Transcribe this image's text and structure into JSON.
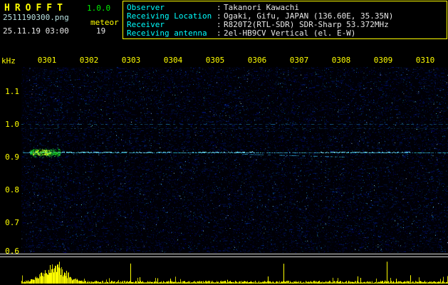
{
  "header": {
    "app_title": "HROFFT",
    "version": "1.0.0",
    "filename": "2511190300.png",
    "mode": "meteor",
    "datetime": "25.11.19 03:00",
    "count": "19",
    "info": {
      "sep": ":",
      "rows": [
        {
          "label": "Observer",
          "value": "Takanori Kawachi"
        },
        {
          "label": "Receiving Location",
          "value": "Ogaki, Gifu, JAPAN (136.60E, 35.35N)"
        },
        {
          "label": "Receiver",
          "value": "R820T2(RTL-SDR) SDR-Sharp 53.372MHz"
        },
        {
          "label": "Receiving antenna",
          "value": "2el-HB9CV Vertical (el. E-W)"
        }
      ]
    }
  },
  "axes": {
    "freq_unit": "kHz",
    "freq_labels": [
      "1.1",
      "1.0",
      "0.9",
      "0.8",
      "0.7",
      "0.6"
    ],
    "time_labels": [
      "0301",
      "0302",
      "0303",
      "0304",
      "0305",
      "0306",
      "0307",
      "0308",
      "0309",
      "0310"
    ]
  },
  "colors": {
    "accent_yellow": "#ffff00",
    "label_cyan": "#00ffff",
    "value_white": "#e8e8e8",
    "carrier_cyan": "#00d4ff",
    "echo_green": "#00ff00",
    "noise_blue": "#0000aa"
  },
  "spectrogram": {
    "freq_range_khz": [
      0.6,
      1.17
    ],
    "time_range": [
      "0301",
      "0310"
    ],
    "carrier_khz": 0.91,
    "interference_khz": 1.0,
    "echo": {
      "time": "0301",
      "khz": 0.91
    },
    "seed": 20251119
  }
}
